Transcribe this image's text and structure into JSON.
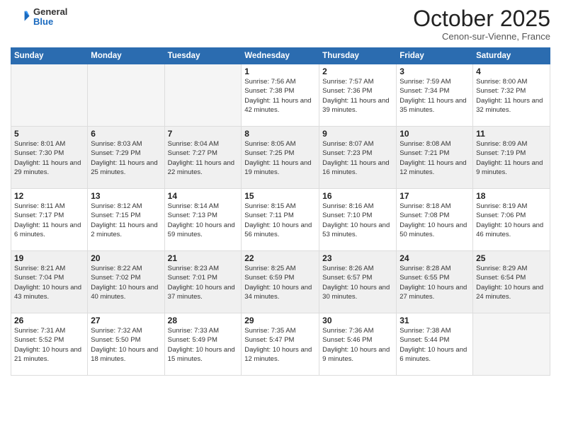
{
  "header": {
    "logo_general": "General",
    "logo_blue": "Blue",
    "month_title": "October 2025",
    "subtitle": "Cenon-sur-Vienne, France"
  },
  "weekdays": [
    "Sunday",
    "Monday",
    "Tuesday",
    "Wednesday",
    "Thursday",
    "Friday",
    "Saturday"
  ],
  "weeks": [
    [
      {
        "day": "",
        "empty": true
      },
      {
        "day": "",
        "empty": true
      },
      {
        "day": "",
        "empty": true
      },
      {
        "day": "1",
        "sunrise": "7:56 AM",
        "sunset": "7:38 PM",
        "daylight": "11 hours and 42 minutes."
      },
      {
        "day": "2",
        "sunrise": "7:57 AM",
        "sunset": "7:36 PM",
        "daylight": "11 hours and 39 minutes."
      },
      {
        "day": "3",
        "sunrise": "7:59 AM",
        "sunset": "7:34 PM",
        "daylight": "11 hours and 35 minutes."
      },
      {
        "day": "4",
        "sunrise": "8:00 AM",
        "sunset": "7:32 PM",
        "daylight": "11 hours and 32 minutes."
      }
    ],
    [
      {
        "day": "5",
        "sunrise": "8:01 AM",
        "sunset": "7:30 PM",
        "daylight": "11 hours and 29 minutes."
      },
      {
        "day": "6",
        "sunrise": "8:03 AM",
        "sunset": "7:29 PM",
        "daylight": "11 hours and 25 minutes."
      },
      {
        "day": "7",
        "sunrise": "8:04 AM",
        "sunset": "7:27 PM",
        "daylight": "11 hours and 22 minutes."
      },
      {
        "day": "8",
        "sunrise": "8:05 AM",
        "sunset": "7:25 PM",
        "daylight": "11 hours and 19 minutes."
      },
      {
        "day": "9",
        "sunrise": "8:07 AM",
        "sunset": "7:23 PM",
        "daylight": "11 hours and 16 minutes."
      },
      {
        "day": "10",
        "sunrise": "8:08 AM",
        "sunset": "7:21 PM",
        "daylight": "11 hours and 12 minutes."
      },
      {
        "day": "11",
        "sunrise": "8:09 AM",
        "sunset": "7:19 PM",
        "daylight": "11 hours and 9 minutes."
      }
    ],
    [
      {
        "day": "12",
        "sunrise": "8:11 AM",
        "sunset": "7:17 PM",
        "daylight": "11 hours and 6 minutes."
      },
      {
        "day": "13",
        "sunrise": "8:12 AM",
        "sunset": "7:15 PM",
        "daylight": "11 hours and 2 minutes."
      },
      {
        "day": "14",
        "sunrise": "8:14 AM",
        "sunset": "7:13 PM",
        "daylight": "10 hours and 59 minutes."
      },
      {
        "day": "15",
        "sunrise": "8:15 AM",
        "sunset": "7:11 PM",
        "daylight": "10 hours and 56 minutes."
      },
      {
        "day": "16",
        "sunrise": "8:16 AM",
        "sunset": "7:10 PM",
        "daylight": "10 hours and 53 minutes."
      },
      {
        "day": "17",
        "sunrise": "8:18 AM",
        "sunset": "7:08 PM",
        "daylight": "10 hours and 50 minutes."
      },
      {
        "day": "18",
        "sunrise": "8:19 AM",
        "sunset": "7:06 PM",
        "daylight": "10 hours and 46 minutes."
      }
    ],
    [
      {
        "day": "19",
        "sunrise": "8:21 AM",
        "sunset": "7:04 PM",
        "daylight": "10 hours and 43 minutes."
      },
      {
        "day": "20",
        "sunrise": "8:22 AM",
        "sunset": "7:02 PM",
        "daylight": "10 hours and 40 minutes."
      },
      {
        "day": "21",
        "sunrise": "8:23 AM",
        "sunset": "7:01 PM",
        "daylight": "10 hours and 37 minutes."
      },
      {
        "day": "22",
        "sunrise": "8:25 AM",
        "sunset": "6:59 PM",
        "daylight": "10 hours and 34 minutes."
      },
      {
        "day": "23",
        "sunrise": "8:26 AM",
        "sunset": "6:57 PM",
        "daylight": "10 hours and 30 minutes."
      },
      {
        "day": "24",
        "sunrise": "8:28 AM",
        "sunset": "6:55 PM",
        "daylight": "10 hours and 27 minutes."
      },
      {
        "day": "25",
        "sunrise": "8:29 AM",
        "sunset": "6:54 PM",
        "daylight": "10 hours and 24 minutes."
      }
    ],
    [
      {
        "day": "26",
        "sunrise": "7:31 AM",
        "sunset": "5:52 PM",
        "daylight": "10 hours and 21 minutes."
      },
      {
        "day": "27",
        "sunrise": "7:32 AM",
        "sunset": "5:50 PM",
        "daylight": "10 hours and 18 minutes."
      },
      {
        "day": "28",
        "sunrise": "7:33 AM",
        "sunset": "5:49 PM",
        "daylight": "10 hours and 15 minutes."
      },
      {
        "day": "29",
        "sunrise": "7:35 AM",
        "sunset": "5:47 PM",
        "daylight": "10 hours and 12 minutes."
      },
      {
        "day": "30",
        "sunrise": "7:36 AM",
        "sunset": "5:46 PM",
        "daylight": "10 hours and 9 minutes."
      },
      {
        "day": "31",
        "sunrise": "7:38 AM",
        "sunset": "5:44 PM",
        "daylight": "10 hours and 6 minutes."
      },
      {
        "day": "",
        "empty": true
      }
    ]
  ],
  "labels": {
    "sunrise": "Sunrise:",
    "sunset": "Sunset:",
    "daylight": "Daylight:"
  }
}
